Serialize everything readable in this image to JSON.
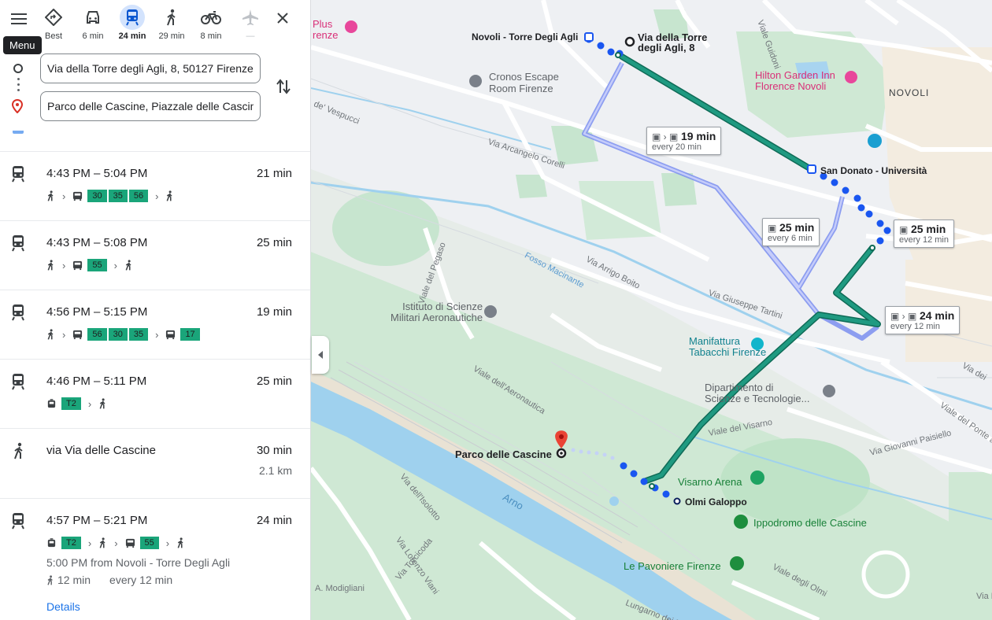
{
  "header": {
    "menu_tooltip": "Menu",
    "modes": [
      {
        "name": "best",
        "label": "Best"
      },
      {
        "name": "driving",
        "label": "6 min"
      },
      {
        "name": "transit",
        "label": "24 min"
      },
      {
        "name": "walking",
        "label": "29 min"
      },
      {
        "name": "cycling",
        "label": "8 min"
      },
      {
        "name": "flights",
        "label": "—"
      }
    ]
  },
  "search": {
    "origin": "Via della Torre degli Agli, 8, 50127 Firenze",
    "destination": "Parco delle Cascine, Piazzale delle Cascine"
  },
  "routes": [
    {
      "times": "4:43 PM – 5:04 PM",
      "duration": "21 min",
      "lines": [
        "30",
        "35",
        "56"
      ]
    },
    {
      "times": "4:43 PM – 5:08 PM",
      "duration": "25 min",
      "lines": [
        "55"
      ]
    },
    {
      "times": "4:56 PM – 5:15 PM",
      "duration": "19 min",
      "lines_a": [
        "56",
        "30",
        "35"
      ],
      "lines_b": [
        "17"
      ]
    },
    {
      "times": "4:46 PM – 5:11 PM",
      "duration": "25 min",
      "lines": [
        "T2"
      ]
    },
    {
      "times": "via Via delle Cascine",
      "duration": "30 min",
      "distance": "2.1 km"
    },
    {
      "times": "4:57 PM – 5:21 PM",
      "duration": "24 min",
      "lines_a": [
        "T2"
      ],
      "lines_b": [
        "55"
      ],
      "departure": "5:00 PM from Novoli - Torre Degli Agli",
      "walk_time": "12 min",
      "frequency": "every 12 min",
      "details": "Details"
    }
  ],
  "map": {
    "places": {
      "origin": "Via della Torre\ndegli Agli, 8",
      "origin_line1": "Via della Torre",
      "origin_line2": "degli Agli, 8",
      "stop_start": "Novoli - Torre Degli Agli",
      "stop_mid": "San Donato - Università",
      "stop_end": "Olmi Galoppo",
      "destination": "Parco delle Cascine",
      "neighborhood": "NOVOLI",
      "poi1_line1": "Cronos Escape",
      "poi1_line2": "Room Firenze",
      "poi2_line1": "Hilton Garden Inn",
      "poi2_line2": "Florence Novoli",
      "poi3_line1": "Istituto di Scienze",
      "poi3_line2": "Militari Aeronautiche",
      "poi4_line1": "Manifattura",
      "poi4_line2": "Tabacchi Firenze",
      "poi5_line1": "Dipartimento di",
      "poi5_line2": "Scienze e Tecnologie...",
      "poi6": "Visarno Arena",
      "poi7": "Ippodromo delle Cascine",
      "poi8": "Le Pavoniere Firenze",
      "poi9_line1": "Plus",
      "poi9_line2": "renze",
      "river": "Arno"
    },
    "streets": {
      "s1": "Via Arcangelo Corelli",
      "s2": "Viale del Pegaso",
      "s3": "Fosso Macinante",
      "s4": "Via Arrigo Boito",
      "s5": "Via Giuseppe Tartini",
      "s6": "Viale dell'Aeronautica",
      "s7": "Viale del Visarno",
      "s8": "Via Giovanni Paisiello",
      "s9": "Viale del Ponte a",
      "s10": "Via dell'Isolotto",
      "s11": "Via Lorenzo Viani",
      "s12": "Via Torcicoda",
      "s13": "A. Modigliani",
      "s14": "Viale degli Olmi",
      "s15": "Lungarno dei Pioppi",
      "s16": "Viale Guidoni",
      "s17": "de' Vespucci",
      "s18": "Via dei",
      "s19": "Via F"
    },
    "callouts": [
      {
        "time": "19 min",
        "freq": "every 20 min"
      },
      {
        "time": "25 min",
        "freq": "every 6 min"
      },
      {
        "time": "25 min",
        "freq": "every 12 min"
      },
      {
        "time": "24 min",
        "freq": "every 12 min"
      }
    ],
    "colors": {
      "route_selected": "#1e8f7a",
      "route_alt": "#7b8ff0",
      "walk": "#1a56f0"
    }
  }
}
